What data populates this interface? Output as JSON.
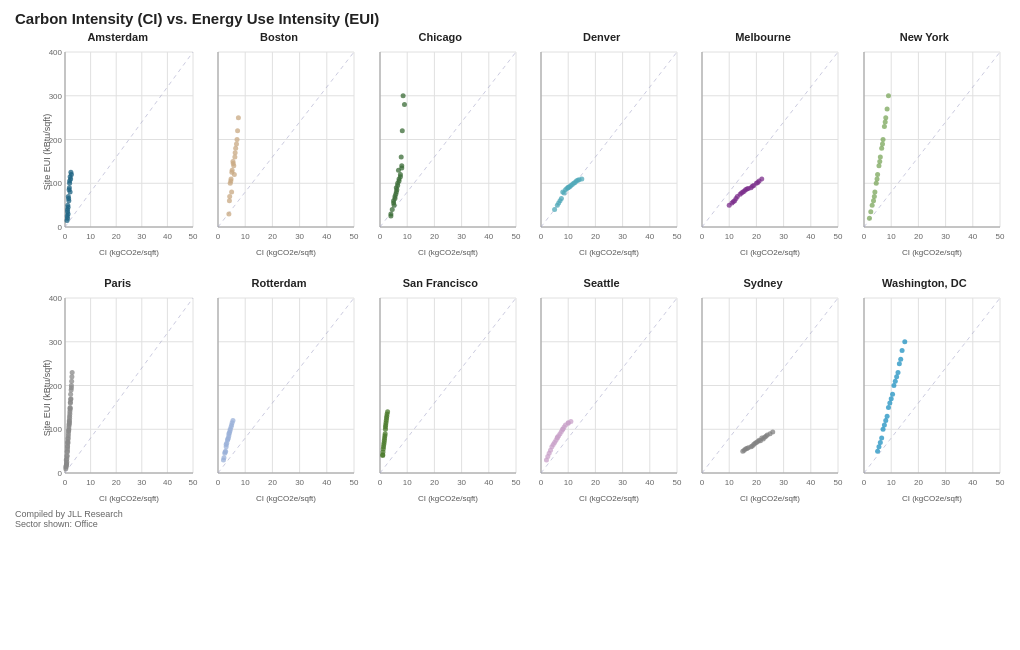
{
  "title": "Carbon Intensity (CI) vs. Energy Use Intensity (EUI)",
  "y_axis_label": "Site EUI (kBtu/sqft)",
  "x_axis_label": "CI (kgCO2e/sqft)",
  "y_ticks": [
    "0",
    "100",
    "200",
    "300",
    "400"
  ],
  "x_ticks": [
    "0",
    "10",
    "20",
    "30",
    "40",
    "50"
  ],
  "footer_line1": "Compiled by JLL Research",
  "footer_line2": "Sector shown: Office",
  "cities_row1": [
    {
      "name": "Amsterdam",
      "color": "#1a6080",
      "dots": [
        [
          1,
          40
        ],
        [
          1.5,
          60
        ],
        [
          2,
          80
        ],
        [
          1.8,
          100
        ],
        [
          2.5,
          120
        ],
        [
          1.2,
          30
        ],
        [
          1,
          20
        ],
        [
          0.8,
          15
        ],
        [
          1.1,
          50
        ],
        [
          1.3,
          70
        ],
        [
          1.7,
          90
        ],
        [
          2.2,
          110
        ],
        [
          1.6,
          85
        ],
        [
          1.4,
          65
        ],
        [
          1,
          35
        ],
        [
          0.9,
          25
        ],
        [
          1.2,
          45
        ],
        [
          1.8,
          105
        ],
        [
          2,
          115
        ],
        [
          2.3,
          125
        ]
      ]
    },
    {
      "name": "Boston",
      "color": "#c8a882",
      "dots": [
        [
          4,
          30
        ],
        [
          5,
          80
        ],
        [
          6,
          120
        ],
        [
          5.5,
          150
        ],
        [
          7,
          200
        ],
        [
          4.5,
          100
        ],
        [
          6.5,
          180
        ],
        [
          5.2,
          130
        ],
        [
          4.8,
          110
        ],
        [
          7.5,
          250
        ],
        [
          6.2,
          160
        ],
        [
          5.8,
          140
        ],
        [
          4.2,
          60
        ],
        [
          6.8,
          190
        ],
        [
          5.1,
          125
        ],
        [
          4.3,
          70
        ],
        [
          7.2,
          220
        ],
        [
          6.3,
          170
        ],
        [
          5.6,
          145
        ],
        [
          4.7,
          105
        ]
      ]
    },
    {
      "name": "Chicago",
      "color": "#3a6b35",
      "dots": [
        [
          4,
          30
        ],
        [
          5,
          60
        ],
        [
          6,
          90
        ],
        [
          7,
          110
        ],
        [
          8,
          140
        ],
        [
          6.5,
          100
        ],
        [
          5.5,
          70
        ],
        [
          7.5,
          120
        ],
        [
          4.5,
          40
        ],
        [
          6,
          80
        ],
        [
          7,
          105
        ],
        [
          5,
          55
        ],
        [
          8,
          135
        ],
        [
          6.5,
          95
        ],
        [
          5.5,
          65
        ],
        [
          4,
          25
        ],
        [
          7.5,
          115
        ],
        [
          6.2,
          85
        ],
        [
          5.8,
          75
        ],
        [
          8.5,
          300
        ],
        [
          9,
          280
        ],
        [
          7.8,
          160
        ],
        [
          6.8,
          130
        ],
        [
          5.2,
          50
        ],
        [
          8.2,
          220
        ]
      ]
    },
    {
      "name": "Denver",
      "color": "#4fa8b8",
      "dots": [
        [
          5,
          40
        ],
        [
          8,
          80
        ],
        [
          10,
          90
        ],
        [
          12,
          100
        ],
        [
          15,
          110
        ],
        [
          7,
          60
        ],
        [
          9,
          85
        ],
        [
          11,
          95
        ],
        [
          13,
          105
        ],
        [
          6,
          50
        ],
        [
          10.5,
          92
        ],
        [
          8.5,
          78
        ],
        [
          14,
          108
        ],
        [
          9.5,
          88
        ],
        [
          7.5,
          65
        ],
        [
          11.5,
          97
        ],
        [
          12.5,
          102
        ],
        [
          6.5,
          55
        ],
        [
          13.5,
          107
        ],
        [
          10,
          91
        ]
      ]
    },
    {
      "name": "Melbourne",
      "color": "#7b2d8b",
      "dots": [
        [
          10,
          50
        ],
        [
          15,
          80
        ],
        [
          18,
          90
        ],
        [
          20,
          100
        ],
        [
          12,
          60
        ],
        [
          14,
          75
        ],
        [
          16,
          85
        ],
        [
          22,
          110
        ],
        [
          11,
          55
        ],
        [
          13,
          70
        ],
        [
          17,
          88
        ],
        [
          19,
          95
        ],
        [
          21,
          105
        ],
        [
          14.5,
          78
        ],
        [
          16.5,
          87
        ],
        [
          11.5,
          58
        ],
        [
          12.5,
          65
        ],
        [
          15.5,
          82
        ],
        [
          18.5,
          93
        ],
        [
          20.5,
          102
        ]
      ]
    },
    {
      "name": "New York",
      "color": "#7aa65a",
      "dots": [
        [
          2,
          20
        ],
        [
          3,
          50
        ],
        [
          4,
          80
        ],
        [
          5,
          120
        ],
        [
          6,
          160
        ],
        [
          7,
          200
        ],
        [
          8,
          250
        ],
        [
          9,
          300
        ],
        [
          3.5,
          60
        ],
        [
          4.5,
          100
        ],
        [
          5.5,
          140
        ],
        [
          6.5,
          180
        ],
        [
          7.5,
          230
        ],
        [
          2.5,
          35
        ],
        [
          3.8,
          70
        ],
        [
          4.8,
          110
        ],
        [
          5.8,
          150
        ],
        [
          6.8,
          190
        ],
        [
          7.8,
          240
        ],
        [
          8.5,
          270
        ]
      ]
    }
  ],
  "cities_row2": [
    {
      "name": "Paris",
      "color": "#888888",
      "dots": [
        [
          0.5,
          30
        ],
        [
          1,
          60
        ],
        [
          1.5,
          100
        ],
        [
          2,
          150
        ],
        [
          1.2,
          80
        ],
        [
          0.8,
          40
        ],
        [
          1.8,
          130
        ],
        [
          0.6,
          20
        ],
        [
          1.3,
          90
        ],
        [
          1.7,
          120
        ],
        [
          2.2,
          180
        ],
        [
          0.7,
          25
        ],
        [
          1.1,
          70
        ],
        [
          1.6,
          110
        ],
        [
          2.5,
          200
        ],
        [
          0.9,
          50
        ],
        [
          1.4,
          95
        ],
        [
          1.9,
          140
        ],
        [
          2.3,
          170
        ],
        [
          0.4,
          15
        ],
        [
          1,
          55
        ],
        [
          1.7,
          115
        ],
        [
          2.1,
          160
        ],
        [
          0.6,
          22
        ],
        [
          1.3,
          85
        ],
        [
          1.8,
          125
        ],
        [
          2.4,
          190
        ],
        [
          0.8,
          38
        ],
        [
          1.5,
          105
        ],
        [
          2,
          148
        ],
        [
          1.1,
          72
        ],
        [
          0.5,
          18
        ],
        [
          1.2,
          78
        ],
        [
          1.9,
          135
        ],
        [
          2.6,
          210
        ],
        [
          0.3,
          10
        ],
        [
          1.0,
          62
        ],
        [
          1.7,
          118
        ],
        [
          2.2,
          168
        ],
        [
          2.8,
          230
        ],
        [
          0.7,
          32
        ],
        [
          1.4,
          97
        ],
        [
          2.0,
          145
        ],
        [
          2.5,
          195
        ],
        [
          0.9,
          48
        ],
        [
          1.6,
          112
        ],
        [
          2.1,
          162
        ],
        [
          2.7,
          220
        ],
        [
          0.4,
          14
        ],
        [
          1.1,
          68
        ]
      ]
    },
    {
      "name": "Rotterdam",
      "color": "#9ab0d8",
      "dots": [
        [
          2,
          30
        ],
        [
          3,
          60
        ],
        [
          4,
          90
        ],
        [
          5,
          110
        ],
        [
          3.5,
          75
        ],
        [
          2.5,
          45
        ],
        [
          4.5,
          100
        ],
        [
          3,
          65
        ],
        [
          4,
          85
        ],
        [
          2.8,
          50
        ],
        [
          3.8,
          80
        ],
        [
          4.2,
          92
        ],
        [
          5.2,
          115
        ],
        [
          2.2,
          35
        ],
        [
          3.2,
          68
        ],
        [
          4.8,
          105
        ],
        [
          2.6,
          48
        ],
        [
          3.6,
          78
        ],
        [
          4.4,
          96
        ],
        [
          5.5,
          120
        ]
      ]
    },
    {
      "name": "San Francisco",
      "color": "#4a7a2a",
      "dots": [
        [
          1,
          40
        ],
        [
          1.5,
          70
        ],
        [
          2,
          100
        ],
        [
          2.5,
          130
        ],
        [
          1.2,
          55
        ],
        [
          1.8,
          85
        ],
        [
          2.2,
          115
        ],
        [
          1.1,
          48
        ],
        [
          1.7,
          80
        ],
        [
          2.1,
          110
        ],
        [
          1.3,
          60
        ],
        [
          1.9,
          90
        ],
        [
          2.3,
          120
        ],
        [
          1.0,
          42
        ],
        [
          1.6,
          75
        ],
        [
          2.0,
          105
        ],
        [
          1.4,
          65
        ],
        [
          2.4,
          125
        ],
        [
          2.6,
          135
        ],
        [
          2.8,
          140
        ]
      ]
    },
    {
      "name": "Seattle",
      "color": "#c8a0c8",
      "dots": [
        [
          2,
          30
        ],
        [
          4,
          60
        ],
        [
          6,
          80
        ],
        [
          8,
          100
        ],
        [
          10,
          115
        ],
        [
          3,
          45
        ],
        [
          5,
          70
        ],
        [
          7,
          90
        ],
        [
          9,
          110
        ],
        [
          4.5,
          65
        ],
        [
          6.5,
          85
        ],
        [
          8.5,
          105
        ],
        [
          2.5,
          38
        ],
        [
          5.5,
          75
        ],
        [
          7.5,
          95
        ],
        [
          3.5,
          52
        ],
        [
          6,
          82
        ],
        [
          8,
          100
        ],
        [
          10,
          114
        ],
        [
          11,
          118
        ]
      ]
    },
    {
      "name": "Sydney",
      "color": "#808080",
      "dots": [
        [
          15,
          50
        ],
        [
          18,
          60
        ],
        [
          20,
          70
        ],
        [
          22,
          80
        ],
        [
          25,
          90
        ],
        [
          16,
          55
        ],
        [
          19,
          65
        ],
        [
          21,
          75
        ],
        [
          23,
          82
        ],
        [
          17,
          58
        ],
        [
          20.5,
          72
        ],
        [
          22.5,
          78
        ],
        [
          24,
          87
        ],
        [
          16.5,
          56
        ],
        [
          18.5,
          62
        ],
        [
          21.5,
          74
        ],
        [
          23.5,
          84
        ],
        [
          15.5,
          52
        ],
        [
          19.5,
          68
        ],
        [
          26,
          94
        ]
      ]
    },
    {
      "name": "Washington, DC",
      "color": "#1e90c0",
      "dots": [
        [
          5,
          50
        ],
        [
          7,
          100
        ],
        [
          9,
          150
        ],
        [
          11,
          200
        ],
        [
          13,
          250
        ],
        [
          6,
          70
        ],
        [
          8,
          120
        ],
        [
          10,
          170
        ],
        [
          12,
          220
        ],
        [
          14,
          280
        ],
        [
          5.5,
          60
        ],
        [
          7.5,
          110
        ],
        [
          9.5,
          160
        ],
        [
          11.5,
          210
        ],
        [
          13.5,
          260
        ],
        [
          6.5,
          80
        ],
        [
          8.5,
          130
        ],
        [
          10.5,
          180
        ],
        [
          12.5,
          230
        ],
        [
          15,
          300
        ]
      ]
    }
  ]
}
